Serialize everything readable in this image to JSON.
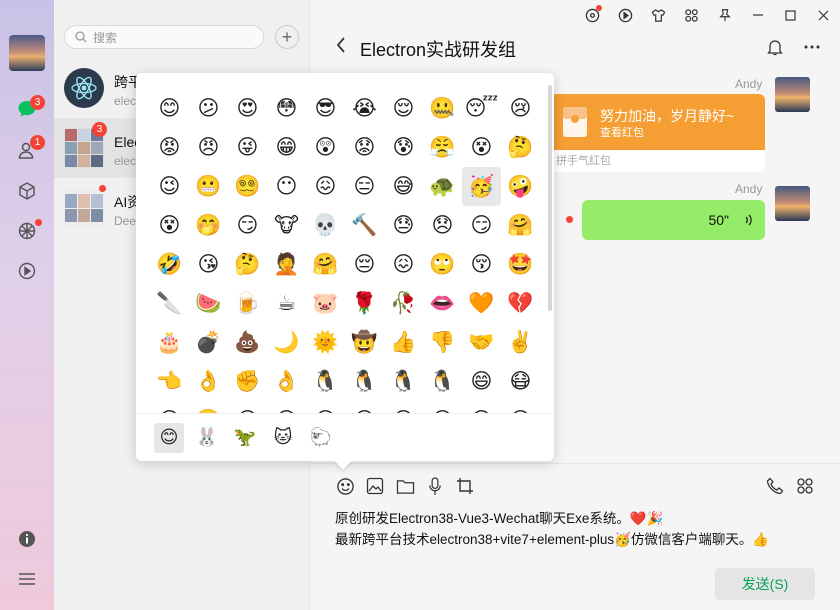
{
  "nav": {
    "chat_badge": "3",
    "contacts_badge": "1"
  },
  "sessions": {
    "search_placeholder": "搜索",
    "add_label": "+",
    "items": [
      {
        "name": "跨平台技术学习",
        "sub": "electron",
        "badge": ""
      },
      {
        "name": "Electron实战研发组",
        "sub": "electron",
        "badge": "3"
      },
      {
        "name": "AI资讯",
        "sub": "Deepseek",
        "badge": ""
      }
    ]
  },
  "chat": {
    "title": "Electron实战研发组",
    "messages": [
      {
        "sender": "Andy",
        "type": "redpacket",
        "text": "努力加油，岁月静好~",
        "action": "查看红包",
        "footer": "拼手气红包"
      },
      {
        "sender": "Andy",
        "type": "voice",
        "duration": "50\""
      }
    ],
    "editor_line1": "原创研发Electron38-Vue3-Wechat聊天Exe系统。❤️🎉",
    "editor_line2": "最新跨平台技术electron38+vite7+element-plus🥳仿微信客户端聊天。👍",
    "send_label": "发送(S)"
  },
  "emoji": {
    "grid": [
      "😊",
      "😕",
      "😍",
      "😳",
      "😎",
      "😭",
      "😌",
      "🤐",
      "😴",
      "😢",
      "😡",
      "😠",
      "😜",
      "😁",
      "😲",
      "😟",
      "😰",
      "😤",
      "😵",
      "🤔",
      "😉",
      "😬",
      "😵‍💫",
      "😶",
      "😖",
      "😑",
      "😅",
      "🐢",
      "🥳",
      "🤪",
      "😵",
      "🤭",
      "😏",
      "🐮",
      "💀",
      "🔨",
      "😓",
      "😞",
      "😏",
      "🤗",
      "🤣",
      "😘",
      "🤔",
      "🤦",
      "🤗",
      "😔",
      "😖",
      "🙄",
      "😚",
      "🤩",
      "🔪",
      "🍉",
      "🍺",
      "☕",
      "🐷",
      "🌹",
      "🥀",
      "👄",
      "🧡",
      "💔",
      "🎂",
      "💣",
      "💩",
      "🌙",
      "🌞",
      "🤠",
      "👍",
      "👎",
      "🤝",
      "✌️",
      "👈",
      "👌",
      "✊",
      "👌",
      "🐧",
      "🐧",
      "🐧",
      "🐧",
      "😄",
      "😷",
      "😁",
      "🙂",
      "😁",
      "😶",
      "😁",
      "😁",
      "😁",
      "😁",
      "😁",
      "😁"
    ],
    "selected_index": 28,
    "tabs": [
      "😊",
      "🐰",
      "🦖",
      "🐱",
      "🐑"
    ]
  },
  "colors": {
    "wechat_green": "#95ec69",
    "redpacket_orange": "#f59e33",
    "send_text": "#07a355",
    "badge_red": "#f44336"
  }
}
